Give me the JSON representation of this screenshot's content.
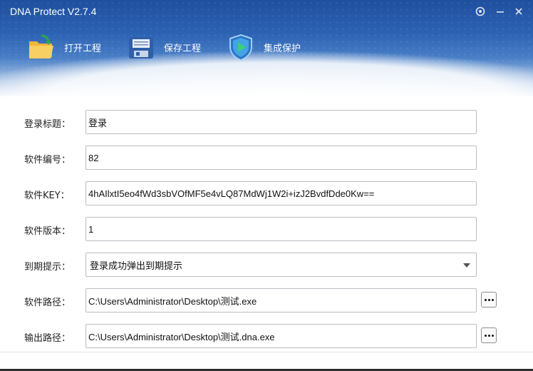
{
  "window": {
    "title": "DNA Protect V2.7.4"
  },
  "toolbar": {
    "items": [
      {
        "label": "打开工程",
        "icon": "open-folder-icon"
      },
      {
        "label": "保存工程",
        "icon": "save-project-icon"
      },
      {
        "label": "集成保护",
        "icon": "shield-protect-icon"
      }
    ]
  },
  "form": {
    "login_title": {
      "label": "登录标题：",
      "value": "登录"
    },
    "software_id": {
      "label": "软件编号：",
      "value": "82"
    },
    "software_key": {
      "label": "软件KEY：",
      "value": "4hAIlxtI5eo4fWd3sbVOfMF5e4vLQ87MdWj1W2i+izJ2BvdfDde0Kw=="
    },
    "software_version": {
      "label": "软件版本：",
      "value": "1"
    },
    "expiry_notice": {
      "label": "到期提示：",
      "selected": "登录成功弹出到期提示"
    },
    "software_path": {
      "label": "软件路径：",
      "value": "C:\\Users\\Administrator\\Desktop\\测试.exe"
    },
    "output_path": {
      "label": "输出路径：",
      "value": "C:\\Users\\Administrator\\Desktop\\测试.dna.exe"
    }
  },
  "colors": {
    "header_dark": "#1f4f9e",
    "header_mid": "#4a7fc6",
    "field_border": "#b9bdc4"
  }
}
